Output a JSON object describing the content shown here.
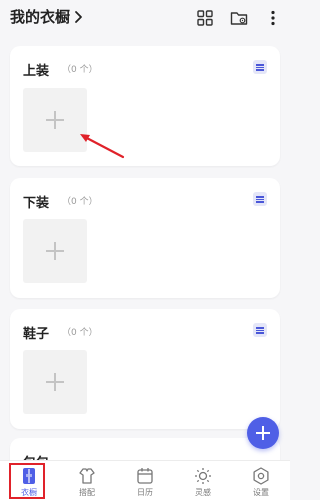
{
  "header": {
    "title": "我的衣橱",
    "icons": [
      "chevron-right-icon",
      "grid-view-icon",
      "folder-settings-icon",
      "more-vertical-icon"
    ]
  },
  "categories": [
    {
      "name": "上装",
      "count": "（0 个）"
    },
    {
      "name": "下装",
      "count": "（0 个）"
    },
    {
      "name": "鞋子",
      "count": "（0 个）"
    },
    {
      "name": "包包",
      "count": ""
    }
  ],
  "bottom_nav": {
    "items": [
      {
        "label": "衣橱",
        "icon": "wardrobe-icon",
        "active": true
      },
      {
        "label": "搭配",
        "icon": "outfit-icon",
        "active": false
      },
      {
        "label": "日历",
        "icon": "calendar-icon",
        "active": false
      },
      {
        "label": "灵感",
        "icon": "inspiration-icon",
        "active": false
      },
      {
        "label": "设置",
        "icon": "settings-icon",
        "active": false
      }
    ]
  },
  "colors": {
    "accent": "#4f5fe6",
    "annotation": "#e0222a",
    "background": "#f6f6f8"
  }
}
